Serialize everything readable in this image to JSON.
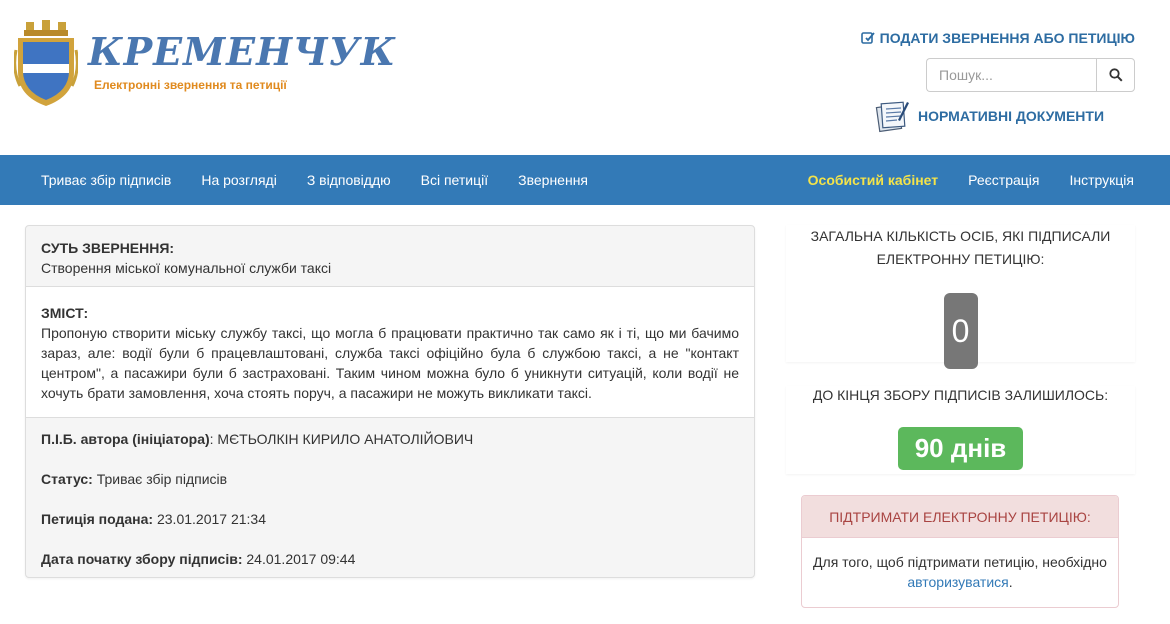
{
  "header": {
    "brand_title": "КРЕМЕНЧУК",
    "brand_subtitle": "Електронні звернення та петиції",
    "submit_link": "ПОДАТИ ЗВЕРНЕННЯ АБО ПЕТИЦІЮ",
    "search_placeholder": "Пошук...",
    "docs_link": "НОРМАТИВНІ ДОКУМЕНТИ"
  },
  "nav": {
    "left": [
      "Триває збір підписів",
      "На розгляді",
      "З відповіддю",
      "Всі петиції",
      "Звернення"
    ],
    "right": [
      "Особистий кабінет",
      "Реєстрація",
      "Інструкція"
    ]
  },
  "petition": {
    "essence_label": "СУТЬ ЗВЕРНЕННЯ:",
    "essence": "Створення міської комунальної служби таксі",
    "content_label": "ЗМІСТ:",
    "content": "Пропоную створити міську службу таксі, що могла б працювати практично так само як і ті, що ми бачимо зараз, але: водії були б працевлаштовані, служба таксі офіційно була б службою таксі, а не \"контакт центром\", а пасажири були б застраховані. Таким чином можна було б уникнути ситуацій, коли водії не хочуть брати замовлення, хоча стоять поруч, а пасажири не можуть викликати таксі.",
    "author_label": "П.І.Б. автора (ініціатора)",
    "author": ": МЄТЬОЛКІН КИРИЛО АНАТОЛІЙОВИЧ",
    "status_label": "Статус:",
    "status": " Триває збір підписів",
    "submitted_label": "Петиція подана:",
    "submitted": " 23.01.2017 21:34",
    "start_label": "Дата початку збору підписів:",
    "start": " 24.01.2017 09:44"
  },
  "sidebar": {
    "count_title": "ЗАГАЛЬНА КІЛЬКІСТЬ ОСІБ, ЯКІ ПІДПИСАЛИ ЕЛЕКТРОННУ ПЕТИЦІЮ:",
    "count": "0",
    "days_title": "ДО КІНЦЯ ЗБОРУ ПІДПИСІВ ЗАЛИШИЛОСЬ:",
    "days": "90 днів",
    "support_title": "ПІДТРИМАТИ ЕЛЕКТРОННУ ПЕТИЦІЮ:",
    "support_text": "Для того, щоб підтримати петицію, необхідно ",
    "support_link": "авторизуватися",
    "support_end": "."
  },
  "colors": {
    "navbar": "#337ab7",
    "highlight": "#f4e34a",
    "badge_gray": "#777777",
    "badge_green": "#5cb85c",
    "support_head": "#f2dede"
  }
}
